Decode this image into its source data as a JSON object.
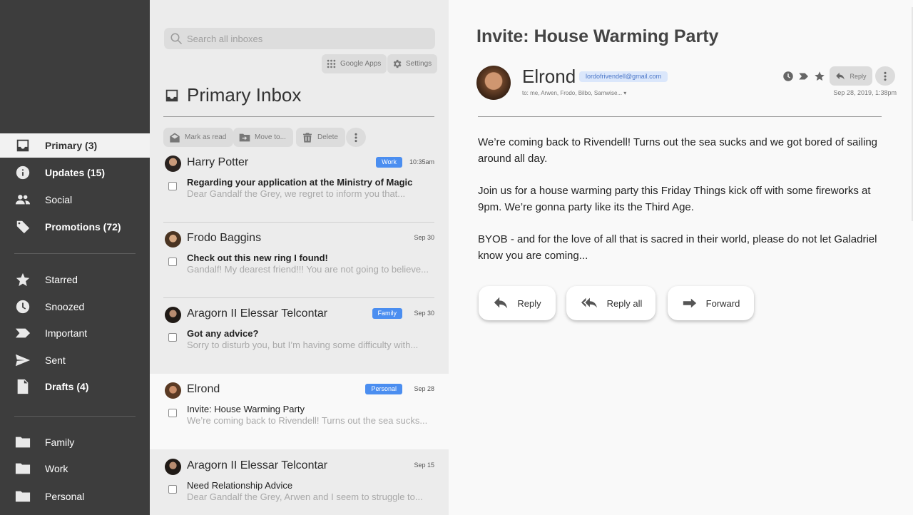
{
  "sidebar": {
    "items": [
      {
        "label": "Primary (3)",
        "icon": "inbox-icon"
      },
      {
        "label": "Updates (15)",
        "icon": "info-icon"
      },
      {
        "label": "Social",
        "icon": "people-icon"
      },
      {
        "label": "Promotions (72)",
        "icon": "tag-icon"
      },
      {
        "label": "Starred",
        "icon": "star-icon"
      },
      {
        "label": "Snoozed",
        "icon": "clock-icon"
      },
      {
        "label": "Important",
        "icon": "important-icon"
      },
      {
        "label": "Sent",
        "icon": "send-icon"
      },
      {
        "label": "Drafts (4)",
        "icon": "draft-icon"
      },
      {
        "label": "Family",
        "icon": "folder-icon"
      },
      {
        "label": "Work",
        "icon": "folder-icon"
      },
      {
        "label": "Personal",
        "icon": "folder-icon"
      }
    ]
  },
  "inbox": {
    "search_placeholder": "Search all inboxes",
    "google_apps_label": "Google Apps",
    "settings_label": "Settings",
    "title": "Primary Inbox",
    "actions": {
      "mark_read": "Mark as read",
      "move_to": "Move to...",
      "delete": "Delete"
    },
    "emails": [
      {
        "sender": "Harry Potter",
        "badge": "Work",
        "time": "10:35am",
        "subject": "Regarding your application at the Ministry of Magic",
        "preview": "Dear Gandalf the Grey, we regret to inform you that..."
      },
      {
        "sender": "Frodo Baggins",
        "badge": "",
        "time": "Sep 30",
        "subject": "Check out this new ring I found!",
        "preview": "Gandalf! My dearest friend!!! You are not going to believe..."
      },
      {
        "sender": "Aragorn II Elessar Telcontar",
        "badge": "Family",
        "time": "Sep 30",
        "subject": "Got any advice?",
        "preview": " Sorry to disturb you, but I’m having some difficulty with..."
      },
      {
        "sender": "Elrond",
        "badge": "Personal",
        "time": "Sep 28",
        "subject": "Invite: House Warming Party",
        "preview": "We’re coming back to Rivendell! Turns out the sea sucks..."
      },
      {
        "sender": "Aragorn II Elessar Telcontar",
        "badge": "",
        "time": "Sep 15",
        "subject": "Need Relationship Advice",
        "preview": "Dear Gandalf the Grey, Arwen and I seem to struggle to..."
      }
    ]
  },
  "reader": {
    "title": "Invite: House Warming Party",
    "sender": "Elrond",
    "email": "lordofrivendell@gmail.com",
    "to": "to: me, Arwen, Frodo, Bilbo, Samwise... ▾",
    "reply_small": "Reply",
    "date": "Sep 28, 2019, 1:38pm",
    "body": [
      "We’re coming back to Rivendell! Turns out the sea sucks and we got bored of sailing around all day.",
      "Join us for a house warming party this Friday Things kick off with some fireworks at 9pm. We’re gonna party like its the Third Age.",
      "BYOB - and for the love of all that is sacred in their world, please do not let Galadriel know you are coming..."
    ],
    "buttons": {
      "reply": "Reply",
      "reply_all": "Reply all",
      "forward": "Forward"
    }
  },
  "colors": {
    "sidebar_bg": "#3d3d3d",
    "badge_blue": "#4b8ef0",
    "accent_email": "#4d78c8"
  }
}
